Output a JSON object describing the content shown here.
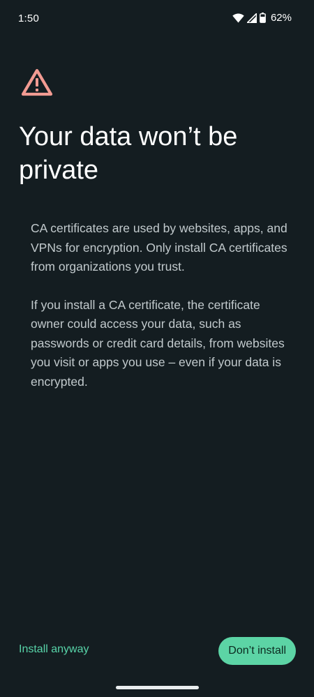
{
  "status_bar": {
    "time": "1:50",
    "battery_percent": "62%",
    "icons": [
      "wifi-icon",
      "cellular-signal-icon",
      "battery-icon"
    ]
  },
  "warning": {
    "icon": "warning-triangle-icon",
    "color": "#f29b92"
  },
  "title": "Your data won’t be private",
  "body": {
    "paragraph_1": "CA certificates are used by websites, apps, and VPNs for encryption. Only install CA certificates from organizations you trust.",
    "paragraph_2": "If you install a CA certificate, the certificate owner could access your data, such as passwords or credit card details, from websites you visit or apps you use – even if your data is encrypted."
  },
  "actions": {
    "install_anyway_label": "Install anyway",
    "dont_install_label": "Don’t install"
  },
  "colors": {
    "background": "#141d21",
    "accent": "#5cd4a5",
    "warning": "#f29b92"
  }
}
